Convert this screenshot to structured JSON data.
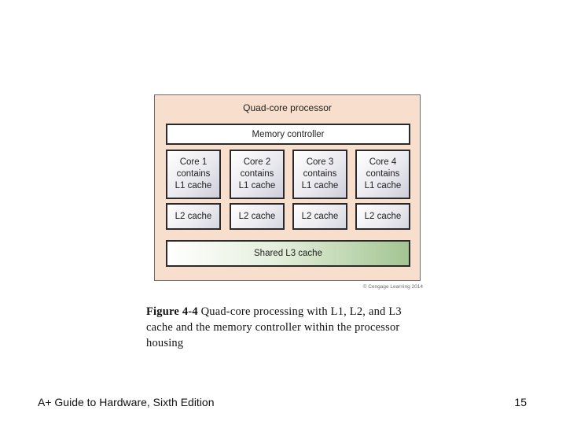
{
  "figure": {
    "title": "Quad-core processor",
    "memory_controller": "Memory controller",
    "cores": [
      {
        "line1": "Core 1",
        "line2": "contains",
        "line3": "L1 cache",
        "l2": "L2 cache"
      },
      {
        "line1": "Core 2",
        "line2": "contains",
        "line3": "L1 cache",
        "l2": "L2 cache"
      },
      {
        "line1": "Core 3",
        "line2": "contains",
        "line3": "L1 cache",
        "l2": "L2 cache"
      },
      {
        "line1": "Core 4",
        "line2": "contains",
        "line3": "L1 cache",
        "l2": "L2 cache"
      }
    ],
    "shared_cache": "Shared L3 cache",
    "copyright": "© Cengage Learning 2014"
  },
  "caption": {
    "label": "Figure 4-4",
    "text": " Quad-core processing with L1, L2, and L3 cache and the memory controller within the processor housing"
  },
  "footer": {
    "book_title": "A+ Guide to Hardware, Sixth Edition",
    "page_number": "15"
  }
}
